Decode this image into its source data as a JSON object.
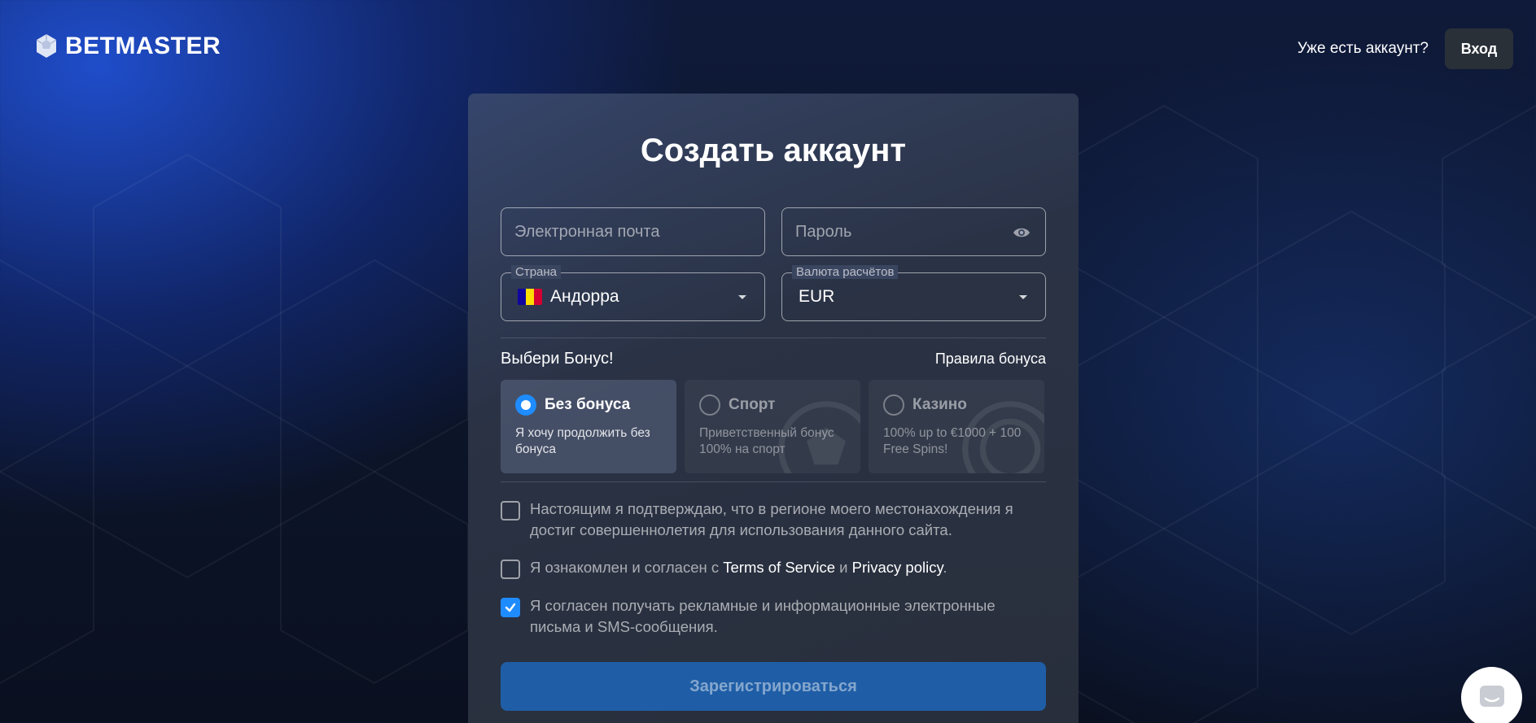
{
  "brand": {
    "name": "BETMASTER"
  },
  "header": {
    "have_account": "Уже есть аккаунт?",
    "login_label": "Вход"
  },
  "form": {
    "title": "Создать аккаунт",
    "email_placeholder": "Электронная почта",
    "password_placeholder": "Пароль",
    "country": {
      "label": "Страна",
      "value": "Андорра",
      "flag_colors": [
        "#10069F",
        "#FEDD00",
        "#D50032"
      ]
    },
    "currency": {
      "label": "Валюта расчётов",
      "value": "EUR"
    },
    "bonus": {
      "title": "Выбери Бонус!",
      "rules_link": "Правила бонуса",
      "options": [
        {
          "name": "Без бонуса",
          "desc": "Я хочу продолжить без бонуса",
          "selected": true
        },
        {
          "name": "Спорт",
          "desc": "Приветственный бонус 100% на спорт",
          "selected": false
        },
        {
          "name": "Казино",
          "desc": "100% up to €1000 + 100 Free Spins!",
          "selected": false
        }
      ]
    },
    "checks": {
      "age": {
        "text": "Настоящим я подтверждаю, что в регионе моего местонахождения я достиг совершеннолетия для использования данного сайта.",
        "checked": false
      },
      "terms": {
        "prefix": "Я ознакомлен и согласен с ",
        "tos": "Terms of Service",
        "and": " и ",
        "privacy": "Privacy policy",
        "suffix": ".",
        "checked": false
      },
      "marketing": {
        "text": "Я согласен получать рекламные и информационные электронные письма и SMS-сообщения.",
        "checked": true
      }
    },
    "submit_label": "Зарегистрироваться"
  },
  "colors": {
    "accent": "#1e8cff",
    "submit_bg": "#1f5ea6",
    "card_bg": "#2c3446"
  }
}
